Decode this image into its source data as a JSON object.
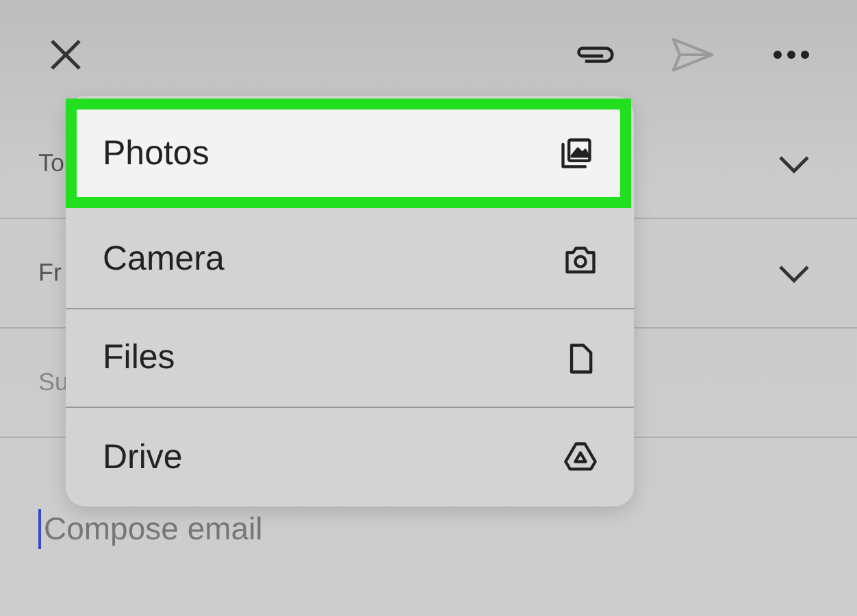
{
  "fields": [
    {
      "label": "To",
      "chevron": true
    },
    {
      "label": "Fr",
      "chevron": true
    },
    {
      "label": "Su",
      "chevron": false
    }
  ],
  "compose": {
    "placeholder": "Compose email"
  },
  "menu": [
    {
      "label": "Photos",
      "kind": "photos",
      "selected": true
    },
    {
      "label": "Camera",
      "kind": "camera",
      "selected": false
    },
    {
      "label": "Files",
      "kind": "files",
      "selected": false
    },
    {
      "label": "Drive",
      "kind": "drive",
      "selected": false
    }
  ]
}
